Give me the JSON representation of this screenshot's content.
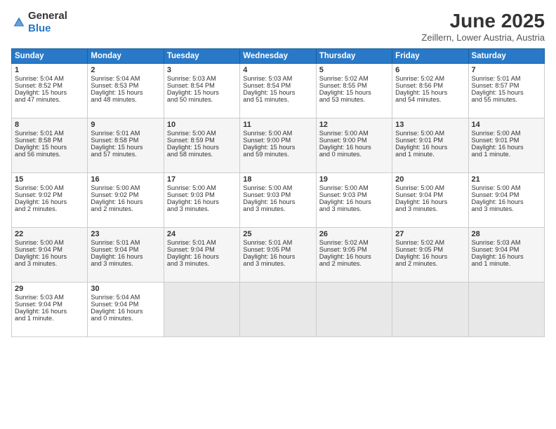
{
  "header": {
    "logo_general": "General",
    "logo_blue": "Blue",
    "month": "June 2025",
    "location": "Zeillern, Lower Austria, Austria"
  },
  "weekdays": [
    "Sunday",
    "Monday",
    "Tuesday",
    "Wednesday",
    "Thursday",
    "Friday",
    "Saturday"
  ],
  "weeks": [
    [
      {
        "day": "1",
        "lines": [
          "Sunrise: 5:04 AM",
          "Sunset: 8:52 PM",
          "Daylight: 15 hours",
          "and 47 minutes."
        ]
      },
      {
        "day": "2",
        "lines": [
          "Sunrise: 5:04 AM",
          "Sunset: 8:53 PM",
          "Daylight: 15 hours",
          "and 48 minutes."
        ]
      },
      {
        "day": "3",
        "lines": [
          "Sunrise: 5:03 AM",
          "Sunset: 8:54 PM",
          "Daylight: 15 hours",
          "and 50 minutes."
        ]
      },
      {
        "day": "4",
        "lines": [
          "Sunrise: 5:03 AM",
          "Sunset: 8:54 PM",
          "Daylight: 15 hours",
          "and 51 minutes."
        ]
      },
      {
        "day": "5",
        "lines": [
          "Sunrise: 5:02 AM",
          "Sunset: 8:55 PM",
          "Daylight: 15 hours",
          "and 53 minutes."
        ]
      },
      {
        "day": "6",
        "lines": [
          "Sunrise: 5:02 AM",
          "Sunset: 8:56 PM",
          "Daylight: 15 hours",
          "and 54 minutes."
        ]
      },
      {
        "day": "7",
        "lines": [
          "Sunrise: 5:01 AM",
          "Sunset: 8:57 PM",
          "Daylight: 15 hours",
          "and 55 minutes."
        ]
      }
    ],
    [
      {
        "day": "8",
        "lines": [
          "Sunrise: 5:01 AM",
          "Sunset: 8:58 PM",
          "Daylight: 15 hours",
          "and 56 minutes."
        ]
      },
      {
        "day": "9",
        "lines": [
          "Sunrise: 5:01 AM",
          "Sunset: 8:58 PM",
          "Daylight: 15 hours",
          "and 57 minutes."
        ]
      },
      {
        "day": "10",
        "lines": [
          "Sunrise: 5:00 AM",
          "Sunset: 8:59 PM",
          "Daylight: 15 hours",
          "and 58 minutes."
        ]
      },
      {
        "day": "11",
        "lines": [
          "Sunrise: 5:00 AM",
          "Sunset: 9:00 PM",
          "Daylight: 15 hours",
          "and 59 minutes."
        ]
      },
      {
        "day": "12",
        "lines": [
          "Sunrise: 5:00 AM",
          "Sunset: 9:00 PM",
          "Daylight: 16 hours",
          "and 0 minutes."
        ]
      },
      {
        "day": "13",
        "lines": [
          "Sunrise: 5:00 AM",
          "Sunset: 9:01 PM",
          "Daylight: 16 hours",
          "and 1 minute."
        ]
      },
      {
        "day": "14",
        "lines": [
          "Sunrise: 5:00 AM",
          "Sunset: 9:01 PM",
          "Daylight: 16 hours",
          "and 1 minute."
        ]
      }
    ],
    [
      {
        "day": "15",
        "lines": [
          "Sunrise: 5:00 AM",
          "Sunset: 9:02 PM",
          "Daylight: 16 hours",
          "and 2 minutes."
        ]
      },
      {
        "day": "16",
        "lines": [
          "Sunrise: 5:00 AM",
          "Sunset: 9:02 PM",
          "Daylight: 16 hours",
          "and 2 minutes."
        ]
      },
      {
        "day": "17",
        "lines": [
          "Sunrise: 5:00 AM",
          "Sunset: 9:03 PM",
          "Daylight: 16 hours",
          "and 3 minutes."
        ]
      },
      {
        "day": "18",
        "lines": [
          "Sunrise: 5:00 AM",
          "Sunset: 9:03 PM",
          "Daylight: 16 hours",
          "and 3 minutes."
        ]
      },
      {
        "day": "19",
        "lines": [
          "Sunrise: 5:00 AM",
          "Sunset: 9:03 PM",
          "Daylight: 16 hours",
          "and 3 minutes."
        ]
      },
      {
        "day": "20",
        "lines": [
          "Sunrise: 5:00 AM",
          "Sunset: 9:04 PM",
          "Daylight: 16 hours",
          "and 3 minutes."
        ]
      },
      {
        "day": "21",
        "lines": [
          "Sunrise: 5:00 AM",
          "Sunset: 9:04 PM",
          "Daylight: 16 hours",
          "and 3 minutes."
        ]
      }
    ],
    [
      {
        "day": "22",
        "lines": [
          "Sunrise: 5:00 AM",
          "Sunset: 9:04 PM",
          "Daylight: 16 hours",
          "and 3 minutes."
        ]
      },
      {
        "day": "23",
        "lines": [
          "Sunrise: 5:01 AM",
          "Sunset: 9:04 PM",
          "Daylight: 16 hours",
          "and 3 minutes."
        ]
      },
      {
        "day": "24",
        "lines": [
          "Sunrise: 5:01 AM",
          "Sunset: 9:04 PM",
          "Daylight: 16 hours",
          "and 3 minutes."
        ]
      },
      {
        "day": "25",
        "lines": [
          "Sunrise: 5:01 AM",
          "Sunset: 9:05 PM",
          "Daylight: 16 hours",
          "and 3 minutes."
        ]
      },
      {
        "day": "26",
        "lines": [
          "Sunrise: 5:02 AM",
          "Sunset: 9:05 PM",
          "Daylight: 16 hours",
          "and 2 minutes."
        ]
      },
      {
        "day": "27",
        "lines": [
          "Sunrise: 5:02 AM",
          "Sunset: 9:05 PM",
          "Daylight: 16 hours",
          "and 2 minutes."
        ]
      },
      {
        "day": "28",
        "lines": [
          "Sunrise: 5:03 AM",
          "Sunset: 9:04 PM",
          "Daylight: 16 hours",
          "and 1 minute."
        ]
      }
    ],
    [
      {
        "day": "29",
        "lines": [
          "Sunrise: 5:03 AM",
          "Sunset: 9:04 PM",
          "Daylight: 16 hours",
          "and 1 minute."
        ]
      },
      {
        "day": "30",
        "lines": [
          "Sunrise: 5:04 AM",
          "Sunset: 9:04 PM",
          "Daylight: 16 hours",
          "and 0 minutes."
        ]
      },
      {
        "day": "",
        "lines": []
      },
      {
        "day": "",
        "lines": []
      },
      {
        "day": "",
        "lines": []
      },
      {
        "day": "",
        "lines": []
      },
      {
        "day": "",
        "lines": []
      }
    ]
  ]
}
